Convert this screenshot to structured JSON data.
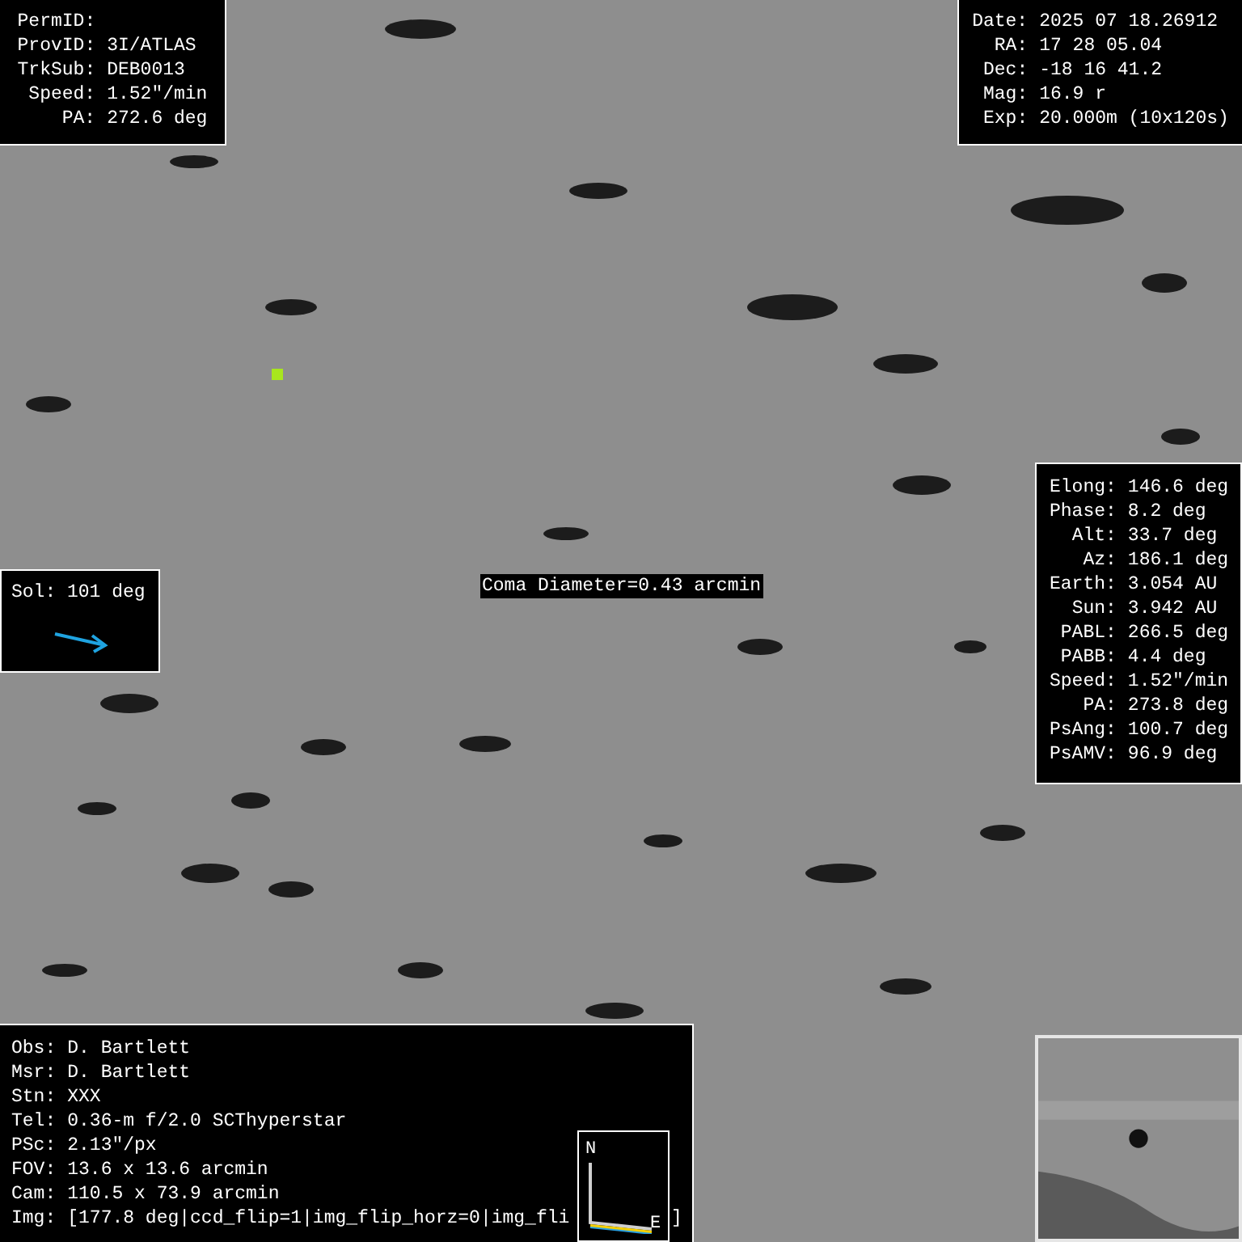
{
  "target_panel": {
    "rows": [
      {
        "label": "PermID:"
      },
      {
        "label": "ProvID:",
        "value": "3I/ATLAS"
      },
      {
        "label": "TrkSub:",
        "value": "DEB0013"
      },
      {
        "label": "Speed:",
        "value": "1.52\"/min"
      },
      {
        "label": "PA:",
        "value": "272.6 deg"
      }
    ]
  },
  "observation_panel": {
    "rows": [
      {
        "label": "Date:",
        "value": "2025 07 18.26912"
      },
      {
        "label": "RA:",
        "value": "17 28 05.04"
      },
      {
        "label": "Dec:",
        "value": "-18 16 41.2"
      },
      {
        "label": "Mag:",
        "value": "16.9 r"
      },
      {
        "label": "Exp:",
        "value": "20.000m (10x120s)"
      }
    ]
  },
  "geometry_panel": {
    "rows": [
      {
        "label": "Elong:",
        "value": "146.6 deg"
      },
      {
        "label": "Phase:",
        "value": "8.2 deg"
      },
      {
        "label": "Alt:",
        "value": "33.7 deg"
      },
      {
        "label": "Az:",
        "value": "186.1 deg"
      },
      {
        "label": "Earth:",
        "value": "3.054 AU"
      },
      {
        "label": "Sun:",
        "value": "3.942 AU"
      },
      {
        "label": "PABL:",
        "value": "266.5 deg"
      },
      {
        "label": "PABB:",
        "value": "4.4 deg"
      },
      {
        "label": "Speed:",
        "value": "1.52\"/min"
      },
      {
        "label": "PA:",
        "value": "273.8 deg"
      },
      {
        "label": "PsAng:",
        "value": "100.7 deg"
      },
      {
        "label": "PsAMV:",
        "value": "96.9 deg"
      }
    ]
  },
  "sol_panel": {
    "label": "Sol: 101 deg"
  },
  "coma_label": "Coma Diameter=0.43 arcmin",
  "info_panel": {
    "rows": [
      {
        "label": "Obs:",
        "value": "D. Bartlett"
      },
      {
        "label": "Msr:",
        "value": "D. Bartlett"
      },
      {
        "label": "Stn:",
        "value": "XXX"
      },
      {
        "label": "Tel:",
        "value": "0.36-m f/2.0 SCThyperstar"
      },
      {
        "label": "PSc:",
        "value": "2.13\"/px"
      },
      {
        "label": "FOV:",
        "value": "13.6 x 13.6 arcmin"
      },
      {
        "label": "Cam:",
        "value": "110.5 x 73.9 arcmin"
      },
      {
        "label": "Img:",
        "value": "[177.8 deg|ccd_flip=1|img_flip_horz=0|img_fli",
        "tail": "]"
      }
    ]
  },
  "compass": {
    "north": "N",
    "east": "E"
  }
}
